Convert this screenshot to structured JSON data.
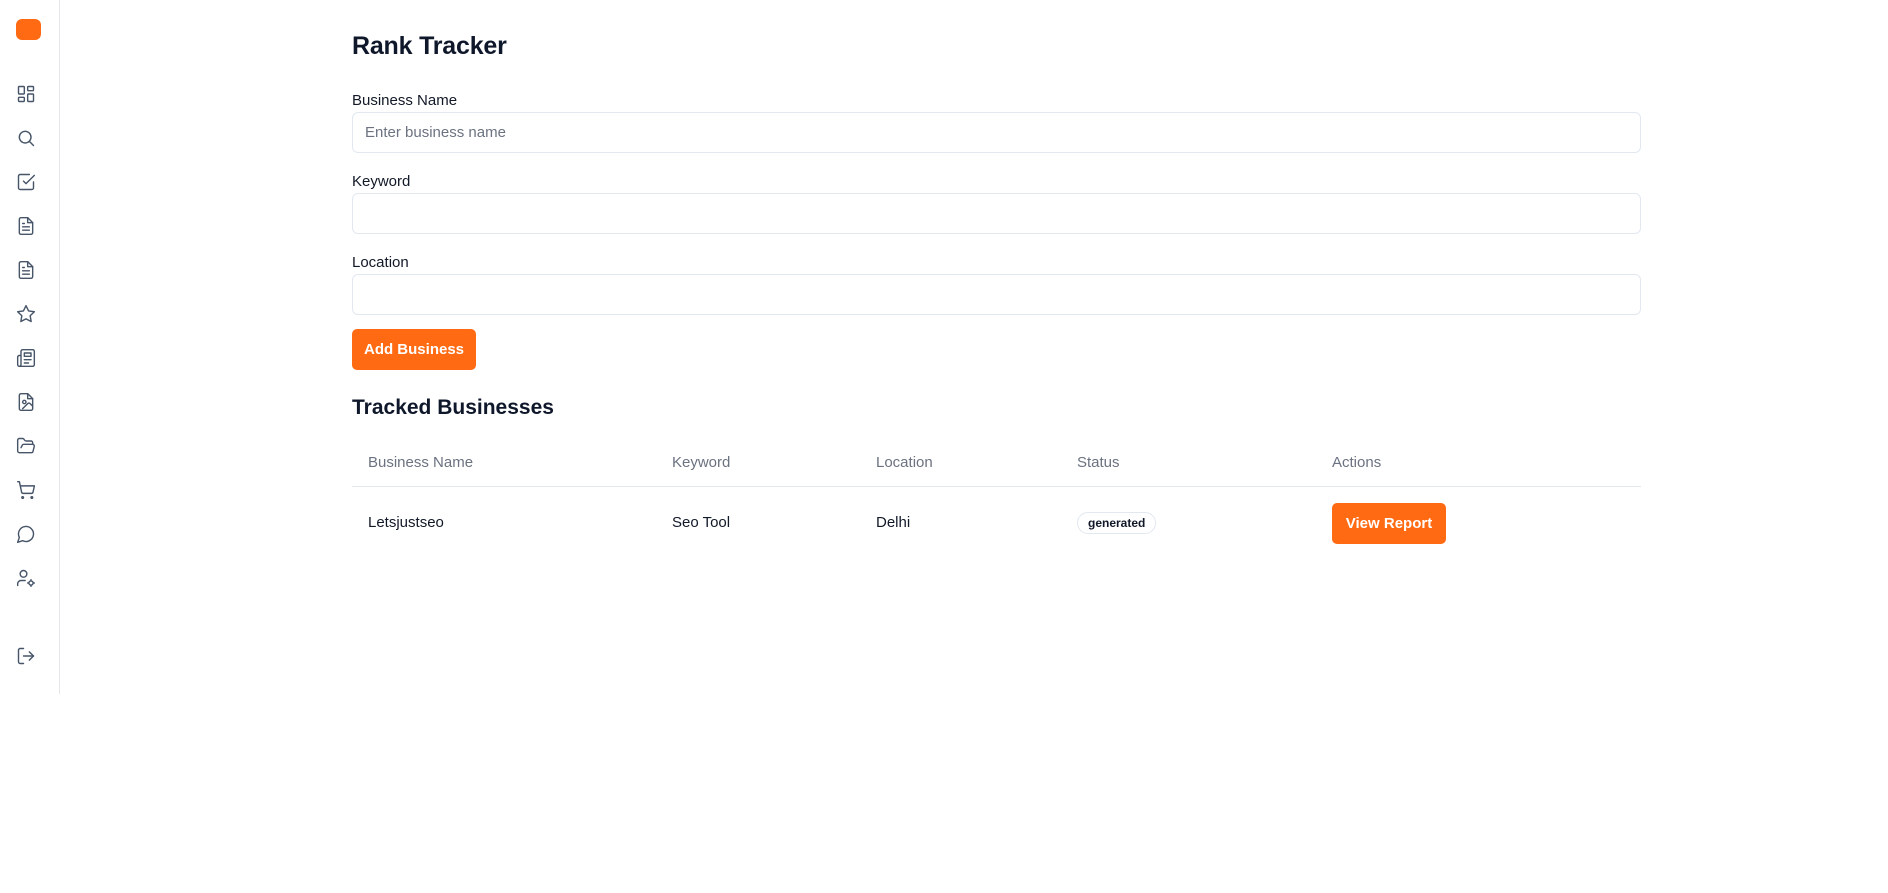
{
  "app": {
    "accent_color": "#ff6a13"
  },
  "sidebar": {
    "logo": "brand-logo",
    "items": [
      {
        "icon": "dashboard-icon",
        "name": "dashboard"
      },
      {
        "icon": "search-icon",
        "name": "search"
      },
      {
        "icon": "checkbox-icon",
        "name": "tasks"
      },
      {
        "icon": "document-icon",
        "name": "document"
      },
      {
        "icon": "document-icon",
        "name": "document-2"
      },
      {
        "icon": "star-icon",
        "name": "favorites"
      },
      {
        "icon": "newspaper-icon",
        "name": "news"
      },
      {
        "icon": "file-image-icon",
        "name": "file-image"
      },
      {
        "icon": "folder-open-icon",
        "name": "folders"
      },
      {
        "icon": "cart-icon",
        "name": "cart"
      },
      {
        "icon": "chat-icon",
        "name": "messages"
      },
      {
        "icon": "user-settings-icon",
        "name": "user-settings"
      }
    ],
    "logout": {
      "icon": "logout-icon"
    }
  },
  "page": {
    "title": "Rank Tracker"
  },
  "form": {
    "business_name": {
      "label": "Business Name",
      "placeholder": "Enter business name",
      "value": ""
    },
    "keyword": {
      "label": "Keyword",
      "placeholder": "",
      "value": ""
    },
    "location": {
      "label": "Location",
      "placeholder": "",
      "value": ""
    },
    "submit_label": "Add Business"
  },
  "tracked": {
    "title": "Tracked Businesses",
    "columns": [
      "Business Name",
      "Keyword",
      "Location",
      "Status",
      "Actions"
    ],
    "rows": [
      {
        "business_name": "Letsjustseo",
        "keyword": "Seo Tool",
        "location": "Delhi",
        "status": "generated",
        "action_label": "View Report"
      }
    ]
  }
}
